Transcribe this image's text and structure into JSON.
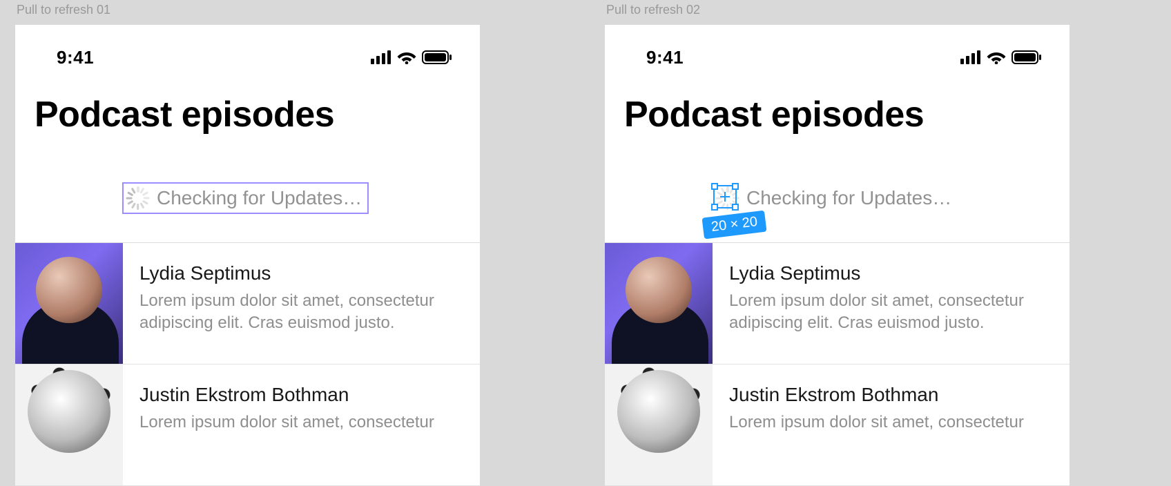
{
  "frames": {
    "left_label": "Pull to refresh 01",
    "right_label": "Pull to refresh 02"
  },
  "status": {
    "time": "9:41"
  },
  "title": "Podcast episodes",
  "refresh": {
    "text": "Checking for Updates…"
  },
  "selection_badge": "20 × 20",
  "episodes": [
    {
      "name": "Lydia Septimus",
      "desc": "Lorem ipsum dolor sit amet, consectetur adipiscing elit. Cras euismod justo."
    },
    {
      "name": "Justin Ekstrom Bothman",
      "desc": "Lorem ipsum dolor sit amet, consectetur"
    }
  ]
}
